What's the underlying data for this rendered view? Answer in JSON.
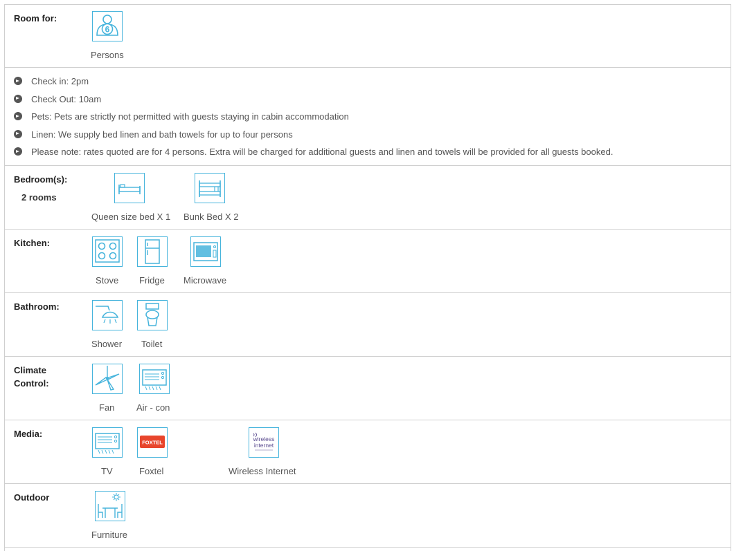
{
  "rows": {
    "room": {
      "label": "Room for:",
      "items": [
        "Persons"
      ],
      "persons_count": "6"
    },
    "notes": {
      "items": [
        "Check in: 2pm",
        "Check Out: 10am",
        "Pets: Pets are strictly not permitted with guests staying in cabin accommodation",
        "Linen: We supply bed linen and bath towels for up to four persons",
        "Please note: rates quoted are for 4 persons. Extra will be charged for additional guests and linen and towels will be provided for all guests booked."
      ]
    },
    "bedroom": {
      "label": "Bedroom(s):",
      "sub": "2 rooms",
      "items": [
        "Queen size bed X 1",
        "Bunk Bed X 2"
      ]
    },
    "kitchen": {
      "label": "Kitchen:",
      "items": [
        "Stove",
        "Fridge",
        "Microwave"
      ]
    },
    "bathroom": {
      "label": "Bathroom:",
      "items": [
        "Shower",
        "Toilet"
      ]
    },
    "climate": {
      "label_line1": "Climate",
      "label_line2": "Control:",
      "items": [
        "Fan",
        "Air - con"
      ]
    },
    "media": {
      "label": "Media:",
      "items": [
        "TV",
        "Foxtel",
        "Wireless Internet"
      ],
      "foxtel_logo": "FOXTEL",
      "wifi_logo_1": "wireless",
      "wifi_logo_2": "internet"
    },
    "outdoor": {
      "label": "Outdoor",
      "items": [
        "Furniture"
      ]
    }
  },
  "colors": {
    "icon_accent": "#46b4dc",
    "border": "#cfcfcf",
    "foxtel": "#e8452c",
    "wifi": "#5a4b8f"
  }
}
